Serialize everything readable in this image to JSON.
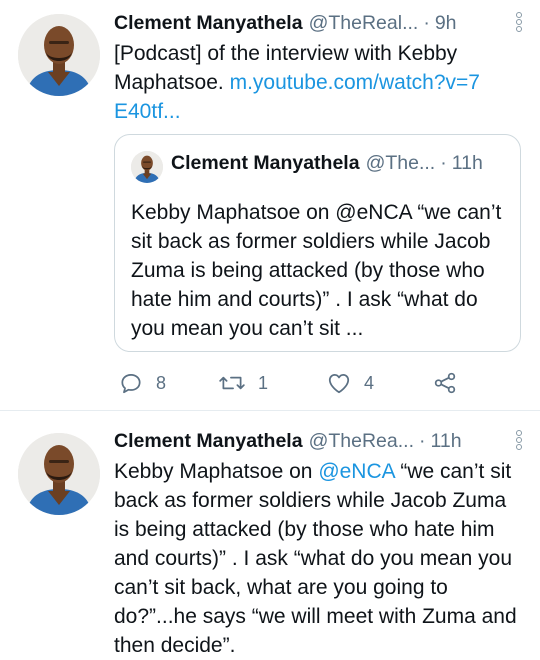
{
  "tweets": [
    {
      "author": "Clement Manyathela",
      "handle": "@TheReal...",
      "dot": "·",
      "time": "9h",
      "text_before": "[Podcast] of the interview with Kebby Maphatsoe. ",
      "link_text": "m.youtube.com/watch?v=7E40tf...",
      "quoted": {
        "author": "Clement Manyathela",
        "handle": "@The...",
        "dot": "·",
        "time": "11h",
        "text": "Kebby Maphatsoe on @eNCA “we can’t sit back as former soldiers while Jacob Zuma is being attacked (by those who hate him and courts)” . I ask “what do you mean you can’t sit ..."
      },
      "actions": {
        "reply_count": "8",
        "retweet_count": "1",
        "like_count": "4"
      }
    },
    {
      "author": "Clement Manyathela",
      "handle": "@TheRea...",
      "dot": "·",
      "time": "11h",
      "text_before": "Kebby Maphatsoe on ",
      "mention": "@eNCA",
      "text_after": " “we can’t sit back as former soldiers while Jacob Zuma is being attacked (by those who hate him and courts)” . I ask “what do you mean you can’t sit back, what are you going to do?”...he says “we will meet with Zuma and then decide”."
    }
  ],
  "colors": {
    "link": "#1b95e0",
    "secondary": "#5b7083",
    "border": "#cfd9de"
  },
  "icons": [
    "reply-icon",
    "retweet-icon",
    "like-icon",
    "share-icon",
    "more-icon"
  ]
}
